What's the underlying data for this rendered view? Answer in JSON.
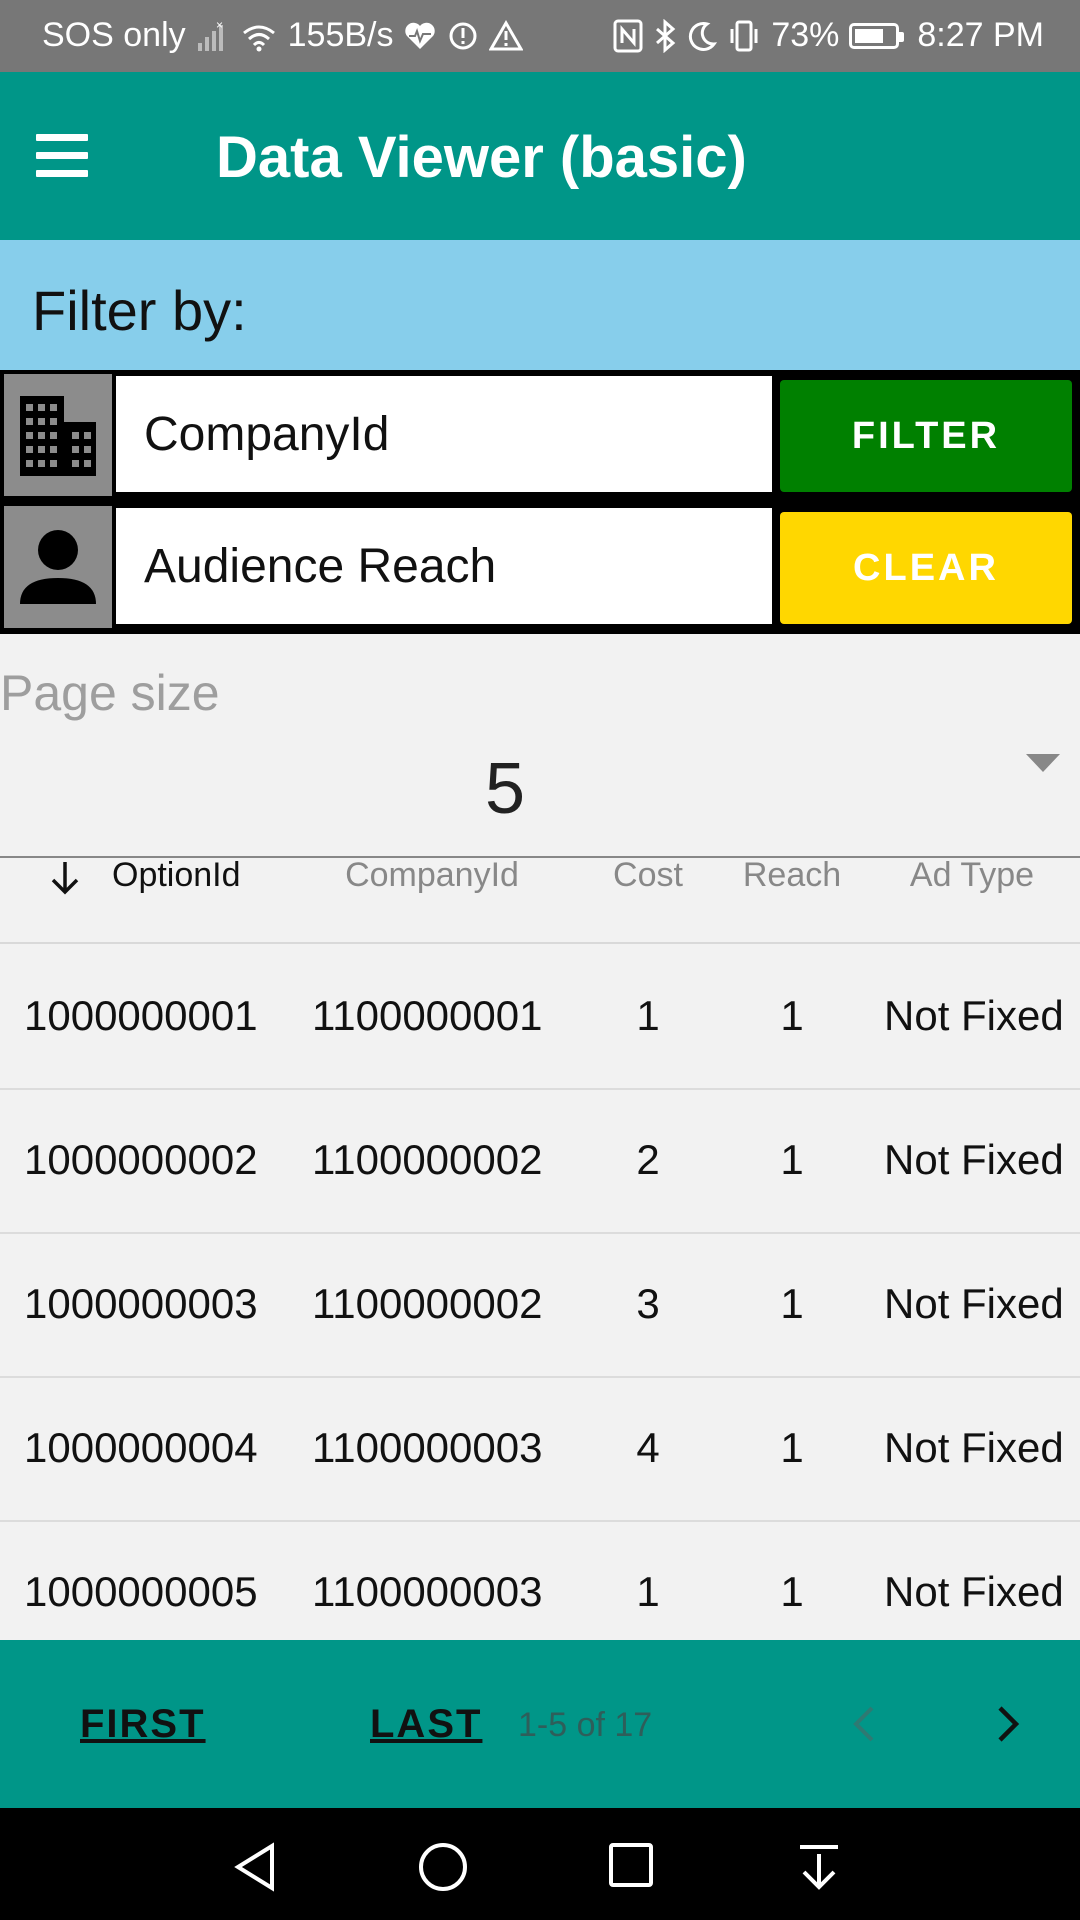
{
  "status_bar": {
    "carrier": "SOS only",
    "network_speed": "155B/s",
    "battery_percent": "73%",
    "battery_level": 0.73,
    "time": "8:27 PM"
  },
  "app_bar": {
    "title": "Data Viewer (basic)"
  },
  "filter": {
    "header_label": "Filter by:",
    "company_field": {
      "value": "CompanyId",
      "icon": "building-icon"
    },
    "audience_field": {
      "value": "Audience Reach",
      "icon": "person-icon"
    },
    "filter_button": {
      "label": "FILTER",
      "color": "#008000"
    },
    "clear_button": {
      "label": "CLEAR",
      "color": "#ffd700"
    }
  },
  "page_size": {
    "label": "Page size",
    "value": "5"
  },
  "table": {
    "columns": [
      "OptionId",
      "CompanyId",
      "Cost",
      "Reach",
      "Ad Type"
    ],
    "sort_column": "OptionId",
    "sort_direction": "descending-arrow",
    "rows": [
      [
        "1000000001",
        "1100000001",
        "1",
        "1",
        "Not Fixed"
      ],
      [
        "1000000002",
        "1100000002",
        "2",
        "1",
        "Not Fixed"
      ],
      [
        "1000000003",
        "1100000002",
        "3",
        "1",
        "Not Fixed"
      ],
      [
        "1000000004",
        "1100000003",
        "4",
        "1",
        "Not Fixed"
      ],
      [
        "1000000005",
        "1100000003",
        "1",
        "1",
        "Not Fixed"
      ]
    ]
  },
  "pager": {
    "first_label": "FIRST",
    "last_label": "LAST",
    "range_text": "1-5 of 17"
  },
  "colors": {
    "primary": "#009688",
    "filter_header_bg": "#87ceeb",
    "status_bar_bg": "#777777"
  }
}
